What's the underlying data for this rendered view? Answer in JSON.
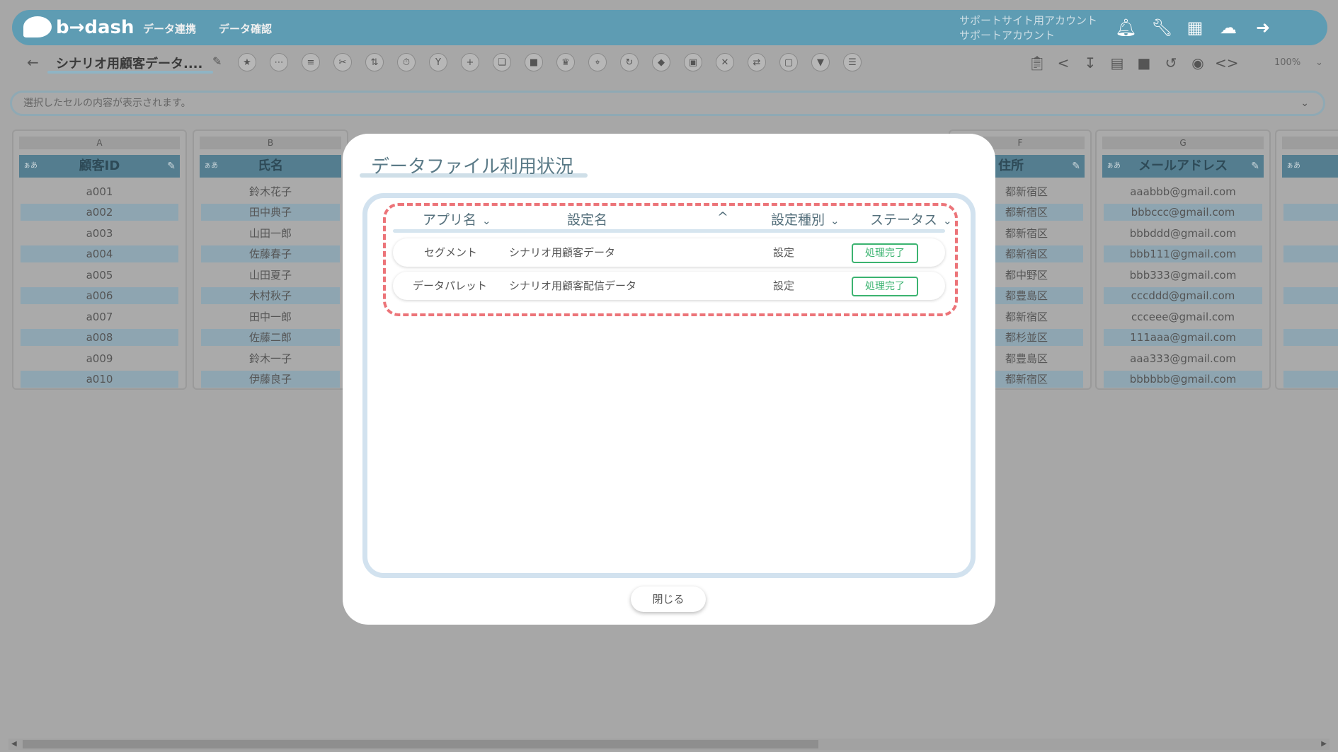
{
  "header": {
    "logo_text": "b→dash",
    "nav": [
      "データ連携",
      "データ確認"
    ],
    "account_line1": "サポートサイト用アカウント",
    "account_line2": "サポートアカウント",
    "icons": [
      "bell-icon",
      "wrench-icon",
      "grid-icon",
      "chat-icon",
      "logout-icon"
    ]
  },
  "toolbar": {
    "back_icon": "←",
    "filename": "シナリオ用顧客データ....",
    "zoom": "100%"
  },
  "formula_bar": {
    "placeholder": "選択したセルの内容が表示されます。"
  },
  "sheet": {
    "columns": [
      {
        "letter": "A",
        "type": "ぁあ",
        "header": "顧客ID",
        "cells": [
          "a001",
          "a002",
          "a003",
          "a004",
          "a005",
          "a006",
          "a007",
          "a008",
          "a009",
          "a010"
        ]
      },
      {
        "letter": "B",
        "type": "ぁあ",
        "header": "氏名",
        "cells": [
          "鈴木花子",
          "田中典子",
          "山田一郎",
          "佐藤春子",
          "山田夏子",
          "木村秋子",
          "田中一郎",
          "佐藤二郎",
          "鈴木一子",
          "伊藤良子"
        ]
      },
      {
        "letter": "F",
        "type": "",
        "header": "住所",
        "cells": [
          "都新宿区",
          "都新宿区",
          "都新宿区",
          "都新宿区",
          "都中野区",
          "都豊島区",
          "都新宿区",
          "都杉並区",
          "都豊島区",
          "都新宿区"
        ]
      },
      {
        "letter": "G",
        "type": "ぁあ",
        "header": "メールアドレス",
        "cells": [
          "aaabbb@gmail.com",
          "bbbccc@gmail.com",
          "bbbddd@gmail.com",
          "bbb111@gmail.com",
          "bbb333@gmail.com",
          "cccddd@gmail.com",
          "ccceee@gmail.com",
          "111aaa@gmail.com",
          "aaa333@gmail.com",
          "bbbbbb@gmail.com"
        ]
      },
      {
        "letter": "",
        "type": "ぁあ",
        "header": "",
        "cells": [
          "",
          "",
          "",
          "",
          "",
          "",
          "",
          "",
          "",
          ""
        ]
      }
    ]
  },
  "modal": {
    "title": "データファイル利用状況",
    "table": {
      "headers": [
        "アプリ名",
        "設定名",
        "設定種別",
        "ステータス"
      ],
      "header_arrows": [
        "⌄",
        "^",
        "⌄",
        "⌄"
      ],
      "rows": [
        {
          "app": "セグメント",
          "setting": "シナリオ用顧客データ",
          "type": "設定",
          "status": "処理完了"
        },
        {
          "app": "データパレット",
          "setting": "シナリオ用顧客配信データ",
          "type": "設定",
          "status": "処理完了"
        }
      ]
    },
    "close_label": "閉じる"
  },
  "colors": {
    "header_bg": "#5e9cb3",
    "highlight_border": "#ec7479",
    "status_green": "#3bb370",
    "panel_border": "#d2e2ef"
  }
}
